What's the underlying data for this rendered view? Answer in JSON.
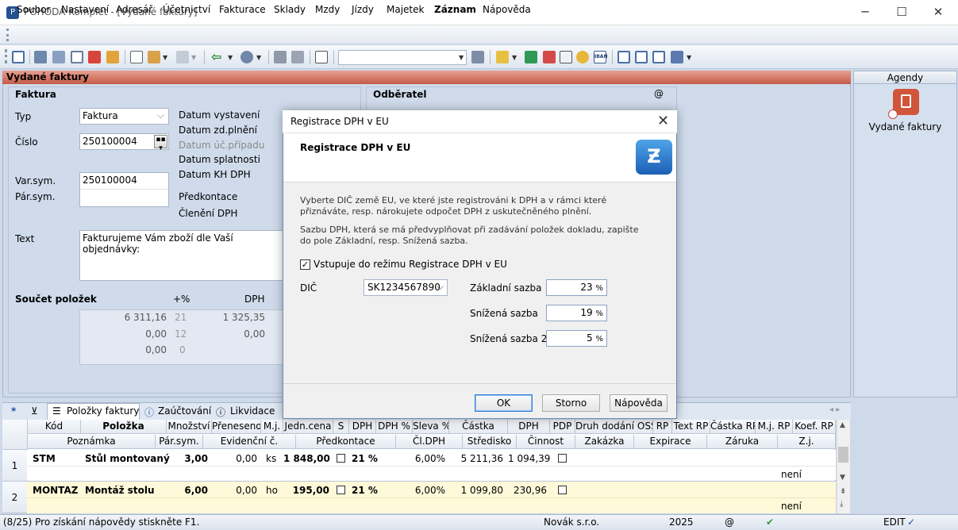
{
  "window": {
    "title": "POHODA Komplet - [Vydané faktury]"
  },
  "menu": [
    "Soubor",
    "Nastavení",
    "Adresář",
    "Účetnictví",
    "Fakturace",
    "Sklady",
    "Mzdy",
    "Jízdy",
    "Majetek",
    "Záznam",
    "Nápověda"
  ],
  "panel": {
    "title": "Vydané faktury"
  },
  "agendy": {
    "title": "Agendy",
    "item": "Vydané faktury"
  },
  "faktura": {
    "section": "Faktura",
    "typ_label": "Typ",
    "typ_value": "Faktura",
    "cislo_label": "Číslo",
    "cislo_value": "250100004",
    "varsym_label": "Var.sym.",
    "varsym_value": "250100004",
    "parsym_label": "Pár.sym.",
    "text_label": "Text",
    "text_value": "Fakturujeme Vám zboží dle Vaší objednávky:",
    "dates": [
      "Datum vystavení",
      "Datum zd.plnění",
      "Datum úč.případu",
      "Datum splatnosti",
      "Datum KH DPH"
    ],
    "predkontace": "Předkontace",
    "cleneni": "Členění DPH"
  },
  "odberatel": {
    "section": "Odběratel",
    "at": "@"
  },
  "soucet": {
    "label": "Součet položek",
    "plus_pct": "+%",
    "dph": "DPH",
    "rows": [
      {
        "base": "6 311,16",
        "rate": "21",
        "dph": "1 325,35"
      },
      {
        "base": "0,00",
        "rate": "12",
        "dph": "0,00"
      },
      {
        "base": "0,00",
        "rate": "0",
        "dph": ""
      }
    ]
  },
  "tabs": [
    "Položky faktury",
    "Zaúčtování",
    "Likvidace"
  ],
  "grid": {
    "header1": [
      "Kód",
      "Položka",
      "Množství",
      "Přeneseno",
      "M.j.",
      "Jedn.cena",
      "S",
      "DPH",
      "DPH %",
      "Sleva %",
      "Částka",
      "DPH",
      "PDP",
      "Druh dodání OSS",
      "RP",
      "Text RP",
      "Částka RP",
      "M.j. RP",
      "Koef. RP"
    ],
    "header2": [
      "Poznámka",
      "Pár.sym.",
      "Evidenční č.",
      "Předkontace",
      "Čl.DPH",
      "Středisko",
      "Činnost",
      "Zakázka",
      "Expirace",
      "Záruka",
      "Z.j."
    ],
    "rows": [
      {
        "num": "1",
        "kod": "STM",
        "polozka": "Stůl montovaný",
        "mnozstvi": "3,00",
        "preneseno": "0,00",
        "mj": "ks",
        "cena": "1 848,00",
        "dph": "21 %",
        "sleva": "6,00%",
        "castka": "5 211,36",
        "dph_castka": "1 094,39",
        "zj": "není"
      },
      {
        "num": "2",
        "kod": "MONTAZ",
        "polozka": "Montáž stolu",
        "mnozstvi": "6,00",
        "preneseno": "0,00",
        "mj": "ho",
        "cena": "195,00",
        "dph": "21 %",
        "sleva": "6,00%",
        "castka": "1 099,80",
        "dph_castka": "230,96",
        "zj": "není"
      }
    ]
  },
  "status": {
    "help": "(8/25) Pro získání nápovědy stiskněte F1.",
    "company": "Novák s.r.o.",
    "year": "2025",
    "at": "@",
    "mode": "EDIT"
  },
  "dialog": {
    "title": "Registrace DPH v EU",
    "heading": "Registrace DPH v EU",
    "text1": "Vyberte DIČ země EU, ve které jste registrováni k DPH a v rámci které přiznáváte, resp. nárokujete odpočet DPH z uskutečněného plnění.",
    "text2": "Sazbu DPH, která se má předvyplňovat při zadávání položek dokladu, zapište do pole Základní, resp. Snížená sazba.",
    "checkbox": "Vstupuje do režimu Registrace DPH v EU",
    "dic_label": "DIČ",
    "dic_value": "SK1234567890",
    "zakladni_label": "Základní sazba",
    "zakladni_value": "23",
    "snizena_label": "Snížená sazba",
    "snizena_value": "19",
    "snizena2_label": "Snížená sazba 2",
    "snizena2_value": "5",
    "pct": "%",
    "ok": "OK",
    "storno": "Storno",
    "napoveda": "Nápověda"
  }
}
